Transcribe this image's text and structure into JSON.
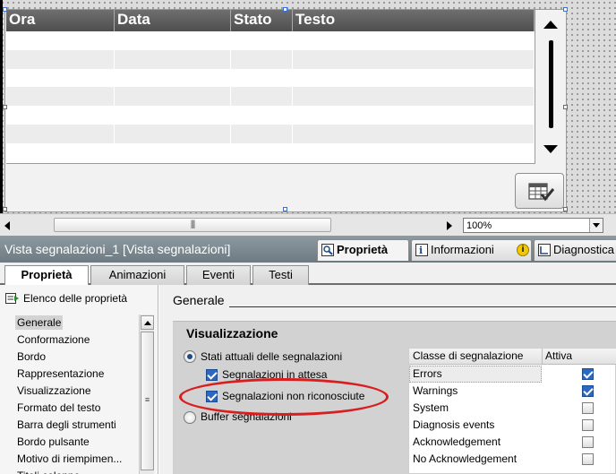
{
  "alarm_view": {
    "columns": [
      "Ora",
      "Data",
      "Stato",
      "Testo"
    ],
    "row_count": 7
  },
  "canvas_bar": {
    "scroll_grip": "|||",
    "zoom": "100%"
  },
  "inspector": {
    "object_title": "Vista segnalazioni_1 [Vista segnalazioni]",
    "tabs": [
      {
        "label": "Proprietà",
        "icon": "properties-icon"
      },
      {
        "label": "Informazioni",
        "icon": "info-icon"
      },
      {
        "label": "Diagnostica",
        "icon": "diagnostics-icon"
      }
    ],
    "warning_badge": "i"
  },
  "subtabs": [
    "Proprietà",
    "Animazioni",
    "Eventi",
    "Testi"
  ],
  "property_list": {
    "header": "Elenco delle proprietà",
    "items": [
      "Generale",
      "Conformazione",
      "Bordo",
      "Rappresentazione",
      "Visualizzazione",
      "Formato del testo",
      "Barra degli strumenti",
      "Bordo pulsante",
      "Motivo di riempimen...",
      "Titoli colonne"
    ],
    "selected_index": 0,
    "scroll_grip": "≡"
  },
  "content": {
    "section_title": "Generale",
    "group_title": "Visualizzazione",
    "options": {
      "current_states": {
        "label": "Stati attuali delle segnalazioni",
        "selected": true
      },
      "pending": {
        "label": "Segnalazioni in attesa",
        "checked": true
      },
      "unacknowledged": {
        "label": "Segnalazioni non riconosciute",
        "checked": true
      },
      "buffer": {
        "label": "Buffer segnalazioni",
        "selected": false
      }
    },
    "class_table": {
      "headers": [
        "Classe di segnalazione",
        "Attiva"
      ],
      "rows": [
        {
          "name": "Errors",
          "active": true
        },
        {
          "name": "Warnings",
          "active": true
        },
        {
          "name": "System",
          "active": false
        },
        {
          "name": "Diagnosis events",
          "active": false
        },
        {
          "name": "Acknowledgement",
          "active": false
        },
        {
          "name": "No Acknowledgement",
          "active": false
        }
      ]
    }
  },
  "colors": {
    "accent": "#2b68c4",
    "annotation": "#d81e1e",
    "header_bg": "#5a5a5a",
    "inspector_bar": "#7d8990"
  }
}
